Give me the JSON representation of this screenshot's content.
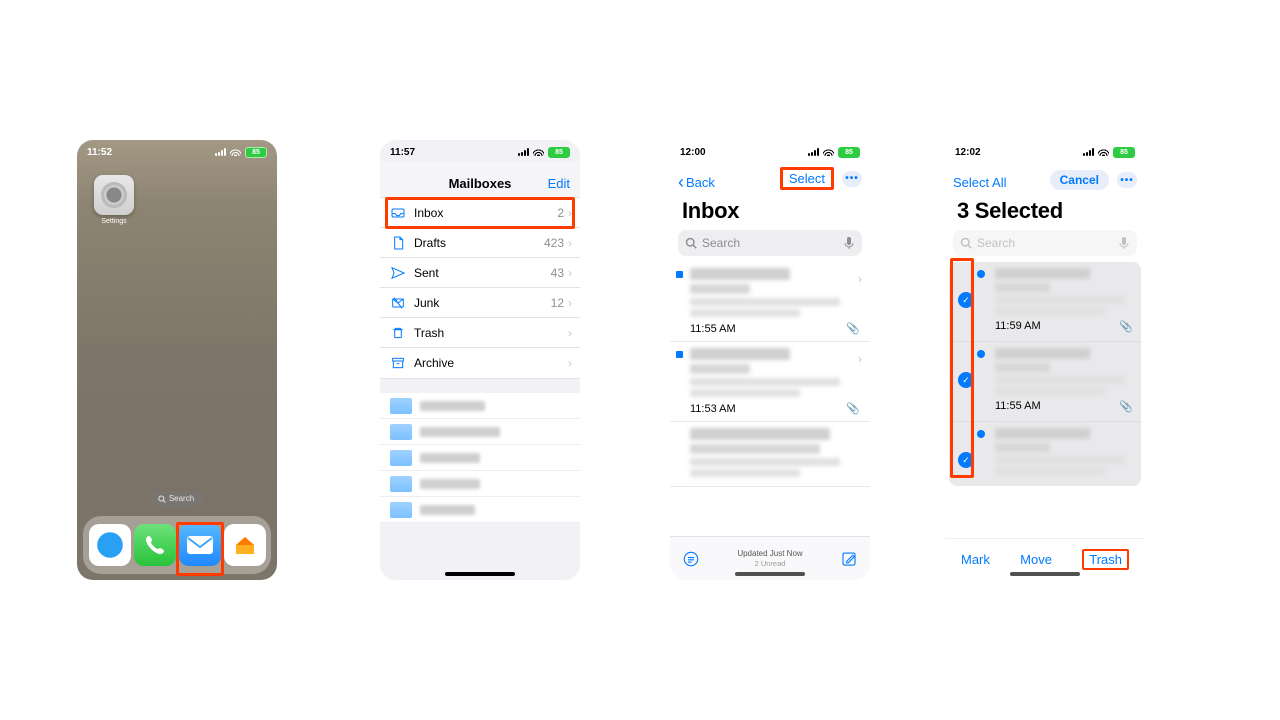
{
  "phone1": {
    "time": "11:52",
    "battery": "85",
    "settings_label": "Settings",
    "search_pill": "Search"
  },
  "phone2": {
    "time": "11:57",
    "battery": "85",
    "title": "Mailboxes",
    "edit": "Edit",
    "rows": [
      {
        "label": "Inbox",
        "count": "2"
      },
      {
        "label": "Drafts",
        "count": "423"
      },
      {
        "label": "Sent",
        "count": "43"
      },
      {
        "label": "Junk",
        "count": "12"
      },
      {
        "label": "Trash",
        "count": ""
      },
      {
        "label": "Archive",
        "count": ""
      }
    ]
  },
  "phone3": {
    "time": "12:00",
    "battery": "85",
    "back": "Back",
    "select": "Select",
    "title": "Inbox",
    "search_placeholder": "Search",
    "messages": [
      {
        "time": "11:55 AM"
      },
      {
        "time": "11:53 AM"
      },
      {
        "time": ""
      }
    ],
    "footer_line1": "Updated Just Now",
    "footer_line2": "2 Unread"
  },
  "phone4": {
    "time": "12:02",
    "battery": "85",
    "select_all": "Select All",
    "cancel": "Cancel",
    "title": "3 Selected",
    "search_placeholder": "Search",
    "messages": [
      {
        "time": "11:59 AM"
      },
      {
        "time": "11:55 AM"
      },
      {
        "time": ""
      }
    ],
    "toolbar": {
      "mark": "Mark",
      "move": "Move",
      "trash": "Trash"
    }
  }
}
